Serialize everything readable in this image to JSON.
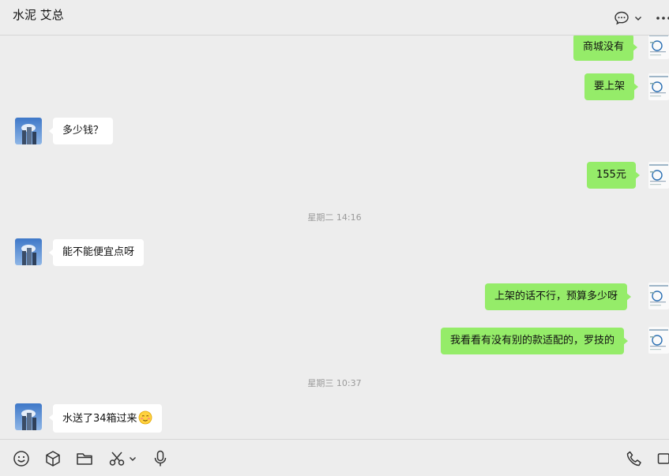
{
  "chat": {
    "title": "水泥 艾总"
  },
  "messages": {
    "m1": "商城没有",
    "m2": "要上架",
    "m3": "多少钱？",
    "m4": "155元",
    "ts1": "星期二 14:16",
    "m5": "能不能便宜点呀",
    "m6": "上架的话不行，预算多少呀",
    "m7": "我看看有没有别的款适配的，罗技的",
    "ts2": "星期三 10:37",
    "m8": "水送了34箱过来"
  },
  "colors": {
    "outgoing_bubble": "#95ec69",
    "incoming_bubble": "#ffffff",
    "background": "#ededed"
  },
  "icons": {
    "header": [
      "chat-info-icon",
      "chevron-down-icon",
      "more-icon"
    ],
    "toolbar": [
      "emoji-icon",
      "cube-icon",
      "folder-icon",
      "scissors-icon",
      "chevron-down-icon",
      "microphone-icon",
      "phone-icon",
      "video-call-icon"
    ]
  }
}
